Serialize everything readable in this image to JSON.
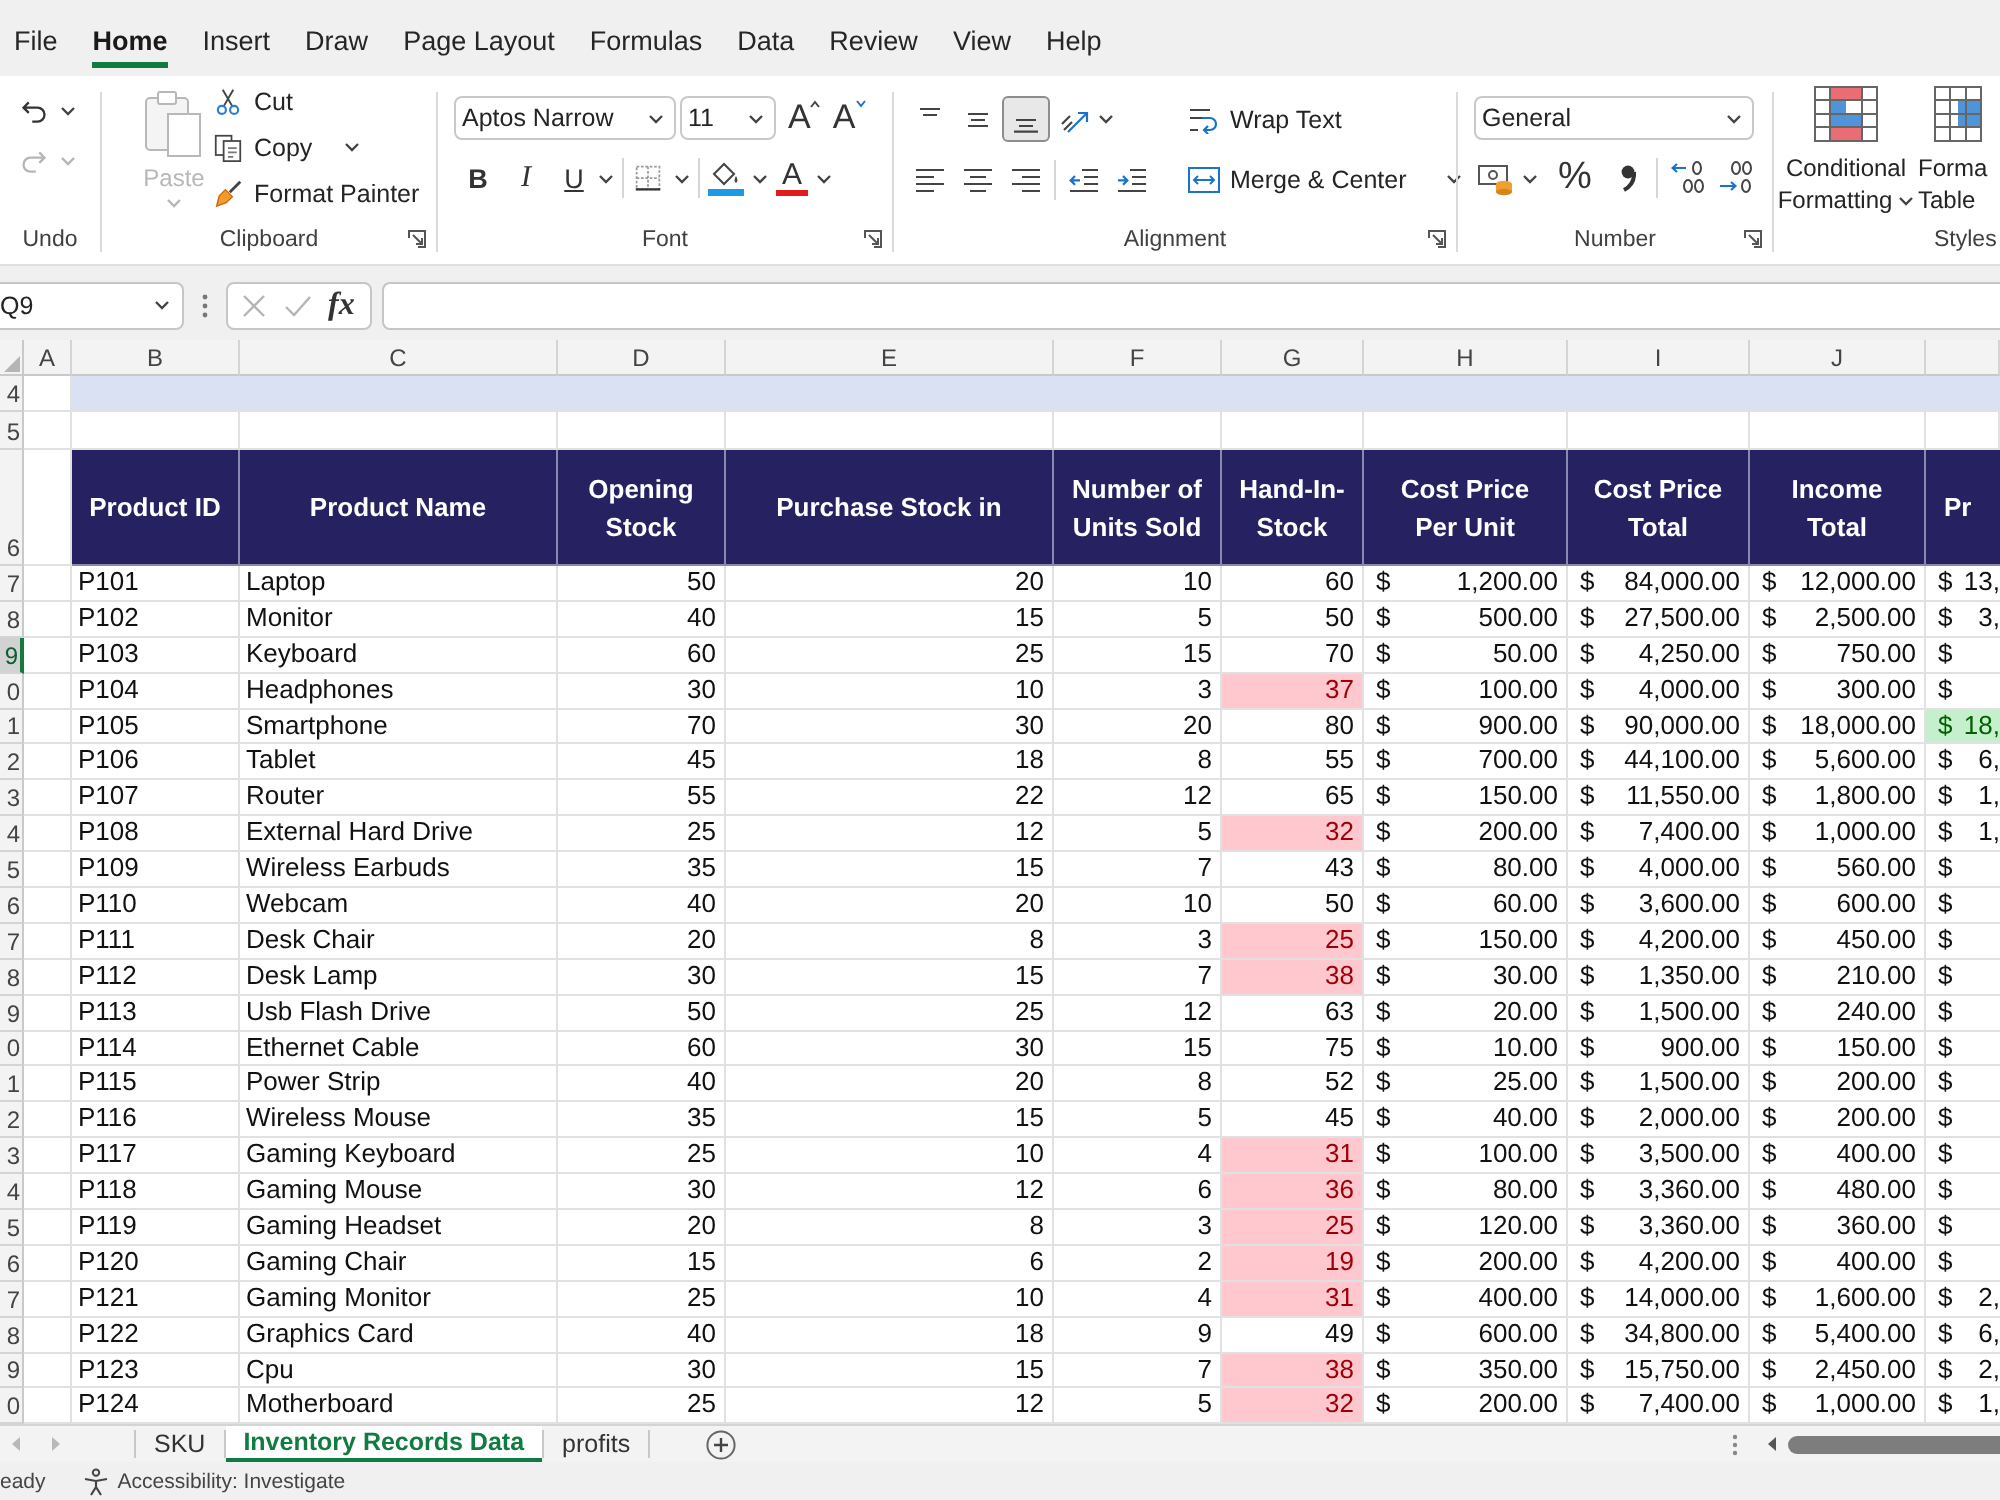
{
  "ribbon_tabs": [
    {
      "label": "File",
      "selected": false
    },
    {
      "label": "Home",
      "selected": true
    },
    {
      "label": "Insert",
      "selected": false
    },
    {
      "label": "Draw",
      "selected": false
    },
    {
      "label": "Page Layout",
      "selected": false
    },
    {
      "label": "Formulas",
      "selected": false
    },
    {
      "label": "Data",
      "selected": false
    },
    {
      "label": "Review",
      "selected": false
    },
    {
      "label": "View",
      "selected": false
    },
    {
      "label": "Help",
      "selected": false
    }
  ],
  "ribbon": {
    "undo": {
      "label": "Undo",
      "undo_disabled": false,
      "redo_disabled": true
    },
    "clipboard": {
      "label": "Clipboard",
      "paste": {
        "label": "Paste",
        "disabled": true
      },
      "cut": "Cut",
      "copy": "Copy",
      "format_painter": "Format Painter"
    },
    "font": {
      "label": "Font",
      "font_name": "Aptos Narrow",
      "font_size": "11",
      "grow_font": "A",
      "shrink_font": "A",
      "bold": "B",
      "italic": "I",
      "underline": "U",
      "font_color": "A"
    },
    "alignment": {
      "label": "Alignment",
      "vertical_align": [
        {
          "selected": false
        },
        {
          "selected": false
        },
        {
          "selected": true
        }
      ],
      "wrap_text": "Wrap Text",
      "merge_center": "Merge & Center"
    },
    "number": {
      "label": "Number",
      "format": "General",
      "percent": "%"
    },
    "styles": {
      "label": "Styles",
      "conditional_formatting": [
        "Conditional",
        "Formatting"
      ],
      "format_as_table": [
        "Forma",
        "Table"
      ]
    }
  },
  "formula_bar": {
    "name_box": "Q9",
    "edit_buttons_disabled": true,
    "function_label": "fx"
  },
  "sheet": {
    "column_letters": [
      "A",
      "B",
      "C",
      "D",
      "E",
      "F",
      "G",
      "H",
      "I",
      "J"
    ],
    "top_rows": [
      {
        "number": "4",
        "kind": "band"
      },
      {
        "number": "5",
        "kind": "blank"
      }
    ],
    "header_row": {
      "number": "6",
      "columns": [
        {
          "heading": "Product ID",
          "kind": "text"
        },
        {
          "heading": "Product Name",
          "kind": "text"
        },
        {
          "heading": "Opening Stock",
          "kind": "number"
        },
        {
          "heading": "Purchase Stock in",
          "kind": "number"
        },
        {
          "heading": "Number of Units Sold",
          "kind": "number"
        },
        {
          "heading": "Hand-In-Stock",
          "kind": "stock"
        },
        {
          "heading": "Cost Price Per Unit",
          "kind": "currency"
        },
        {
          "heading": "Cost Price Total",
          "kind": "currency"
        },
        {
          "heading": "Income Total",
          "kind": "currency"
        },
        {
          "heading": "Pr",
          "kind": "profit"
        }
      ]
    },
    "rows": [
      {
        "number": "7",
        "selected": false,
        "low_stock": false,
        "top_profit": false,
        "cells": [
          "P101",
          "Laptop",
          "50",
          "20",
          "10",
          "60",
          {
            "symbol": "$",
            "amount": "1,200.00"
          },
          {
            "symbol": "$",
            "amount": "84,000.00"
          },
          {
            "symbol": "$",
            "amount": "12,000.00"
          },
          {
            "symbol": "$",
            "amount": "13,"
          }
        ]
      },
      {
        "number": "8",
        "selected": false,
        "low_stock": false,
        "top_profit": false,
        "cells": [
          "P102",
          "Monitor",
          "40",
          "15",
          "5",
          "50",
          {
            "symbol": "$",
            "amount": "500.00"
          },
          {
            "symbol": "$",
            "amount": "27,500.00"
          },
          {
            "symbol": "$",
            "amount": "2,500.00"
          },
          {
            "symbol": "$",
            "amount": "3,"
          }
        ]
      },
      {
        "number": "9",
        "selected": true,
        "low_stock": false,
        "top_profit": false,
        "cells": [
          "P103",
          "Keyboard",
          "60",
          "25",
          "15",
          "70",
          {
            "symbol": "$",
            "amount": "50.00"
          },
          {
            "symbol": "$",
            "amount": "4,250.00"
          },
          {
            "symbol": "$",
            "amount": "750.00"
          },
          {
            "symbol": "$"
          }
        ]
      },
      {
        "number": "0",
        "selected": false,
        "low_stock": true,
        "top_profit": false,
        "cells": [
          "P104",
          "Headphones",
          "30",
          "10",
          "3",
          "37",
          {
            "symbol": "$",
            "amount": "100.00"
          },
          {
            "symbol": "$",
            "amount": "4,000.00"
          },
          {
            "symbol": "$",
            "amount": "300.00"
          },
          {
            "symbol": "$"
          }
        ]
      },
      {
        "number": "1",
        "selected": false,
        "low_stock": false,
        "top_profit": true,
        "cells": [
          "P105",
          "Smartphone",
          "70",
          "30",
          "20",
          "80",
          {
            "symbol": "$",
            "amount": "900.00"
          },
          {
            "symbol": "$",
            "amount": "90,000.00"
          },
          {
            "symbol": "$",
            "amount": "18,000.00"
          },
          {
            "symbol": "$",
            "amount": "18,"
          }
        ]
      },
      {
        "number": "2",
        "selected": false,
        "low_stock": false,
        "top_profit": false,
        "cells": [
          "P106",
          "Tablet",
          "45",
          "18",
          "8",
          "55",
          {
            "symbol": "$",
            "amount": "700.00"
          },
          {
            "symbol": "$",
            "amount": "44,100.00"
          },
          {
            "symbol": "$",
            "amount": "5,600.00"
          },
          {
            "symbol": "$",
            "amount": "6,"
          }
        ]
      },
      {
        "number": "3",
        "selected": false,
        "low_stock": false,
        "top_profit": false,
        "cells": [
          "P107",
          "Router",
          "55",
          "22",
          "12",
          "65",
          {
            "symbol": "$",
            "amount": "150.00"
          },
          {
            "symbol": "$",
            "amount": "11,550.00"
          },
          {
            "symbol": "$",
            "amount": "1,800.00"
          },
          {
            "symbol": "$",
            "amount": "1,"
          }
        ]
      },
      {
        "number": "4",
        "selected": false,
        "low_stock": true,
        "top_profit": false,
        "cells": [
          "P108",
          "External Hard Drive",
          "25",
          "12",
          "5",
          "32",
          {
            "symbol": "$",
            "amount": "200.00"
          },
          {
            "symbol": "$",
            "amount": "7,400.00"
          },
          {
            "symbol": "$",
            "amount": "1,000.00"
          },
          {
            "symbol": "$",
            "amount": "1,"
          }
        ]
      },
      {
        "number": "5",
        "selected": false,
        "low_stock": false,
        "top_profit": false,
        "cells": [
          "P109",
          "Wireless Earbuds",
          "35",
          "15",
          "7",
          "43",
          {
            "symbol": "$",
            "amount": "80.00"
          },
          {
            "symbol": "$",
            "amount": "4,000.00"
          },
          {
            "symbol": "$",
            "amount": "560.00"
          },
          {
            "symbol": "$"
          }
        ]
      },
      {
        "number": "6",
        "selected": false,
        "low_stock": false,
        "top_profit": false,
        "cells": [
          "P110",
          "Webcam",
          "40",
          "20",
          "10",
          "50",
          {
            "symbol": "$",
            "amount": "60.00"
          },
          {
            "symbol": "$",
            "amount": "3,600.00"
          },
          {
            "symbol": "$",
            "amount": "600.00"
          },
          {
            "symbol": "$"
          }
        ]
      },
      {
        "number": "7",
        "selected": false,
        "low_stock": true,
        "top_profit": false,
        "cells": [
          "P111",
          "Desk Chair",
          "20",
          "8",
          "3",
          "25",
          {
            "symbol": "$",
            "amount": "150.00"
          },
          {
            "symbol": "$",
            "amount": "4,200.00"
          },
          {
            "symbol": "$",
            "amount": "450.00"
          },
          {
            "symbol": "$"
          }
        ]
      },
      {
        "number": "8",
        "selected": false,
        "low_stock": true,
        "top_profit": false,
        "cells": [
          "P112",
          "Desk Lamp",
          "30",
          "15",
          "7",
          "38",
          {
            "symbol": "$",
            "amount": "30.00"
          },
          {
            "symbol": "$",
            "amount": "1,350.00"
          },
          {
            "symbol": "$",
            "amount": "210.00"
          },
          {
            "symbol": "$"
          }
        ]
      },
      {
        "number": "9",
        "selected": false,
        "low_stock": false,
        "top_profit": false,
        "cells": [
          "P113",
          "Usb Flash Drive",
          "50",
          "25",
          "12",
          "63",
          {
            "symbol": "$",
            "amount": "20.00"
          },
          {
            "symbol": "$",
            "amount": "1,500.00"
          },
          {
            "symbol": "$",
            "amount": "240.00"
          },
          {
            "symbol": "$"
          }
        ]
      },
      {
        "number": "0",
        "selected": false,
        "low_stock": false,
        "top_profit": false,
        "cells": [
          "P114",
          "Ethernet Cable",
          "60",
          "30",
          "15",
          "75",
          {
            "symbol": "$",
            "amount": "10.00"
          },
          {
            "symbol": "$",
            "amount": "900.00"
          },
          {
            "symbol": "$",
            "amount": "150.00"
          },
          {
            "symbol": "$"
          }
        ]
      },
      {
        "number": "1",
        "selected": false,
        "low_stock": false,
        "top_profit": false,
        "cells": [
          "P115",
          "Power Strip",
          "40",
          "20",
          "8",
          "52",
          {
            "symbol": "$",
            "amount": "25.00"
          },
          {
            "symbol": "$",
            "amount": "1,500.00"
          },
          {
            "symbol": "$",
            "amount": "200.00"
          },
          {
            "symbol": "$"
          }
        ]
      },
      {
        "number": "2",
        "selected": false,
        "low_stock": false,
        "top_profit": false,
        "cells": [
          "P116",
          "Wireless Mouse",
          "35",
          "15",
          "5",
          "45",
          {
            "symbol": "$",
            "amount": "40.00"
          },
          {
            "symbol": "$",
            "amount": "2,000.00"
          },
          {
            "symbol": "$",
            "amount": "200.00"
          },
          {
            "symbol": "$"
          }
        ]
      },
      {
        "number": "3",
        "selected": false,
        "low_stock": true,
        "top_profit": false,
        "cells": [
          "P117",
          "Gaming Keyboard",
          "25",
          "10",
          "4",
          "31",
          {
            "symbol": "$",
            "amount": "100.00"
          },
          {
            "symbol": "$",
            "amount": "3,500.00"
          },
          {
            "symbol": "$",
            "amount": "400.00"
          },
          {
            "symbol": "$"
          }
        ]
      },
      {
        "number": "4",
        "selected": false,
        "low_stock": true,
        "top_profit": false,
        "cells": [
          "P118",
          "Gaming Mouse",
          "30",
          "12",
          "6",
          "36",
          {
            "symbol": "$",
            "amount": "80.00"
          },
          {
            "symbol": "$",
            "amount": "3,360.00"
          },
          {
            "symbol": "$",
            "amount": "480.00"
          },
          {
            "symbol": "$"
          }
        ]
      },
      {
        "number": "5",
        "selected": false,
        "low_stock": true,
        "top_profit": false,
        "cells": [
          "P119",
          "Gaming Headset",
          "20",
          "8",
          "3",
          "25",
          {
            "symbol": "$",
            "amount": "120.00"
          },
          {
            "symbol": "$",
            "amount": "3,360.00"
          },
          {
            "symbol": "$",
            "amount": "360.00"
          },
          {
            "symbol": "$"
          }
        ]
      },
      {
        "number": "6",
        "selected": false,
        "low_stock": true,
        "top_profit": false,
        "cells": [
          "P120",
          "Gaming Chair",
          "15",
          "6",
          "2",
          "19",
          {
            "symbol": "$",
            "amount": "200.00"
          },
          {
            "symbol": "$",
            "amount": "4,200.00"
          },
          {
            "symbol": "$",
            "amount": "400.00"
          },
          {
            "symbol": "$"
          }
        ]
      },
      {
        "number": "7",
        "selected": false,
        "low_stock": true,
        "top_profit": false,
        "cells": [
          "P121",
          "Gaming Monitor",
          "25",
          "10",
          "4",
          "31",
          {
            "symbol": "$",
            "amount": "400.00"
          },
          {
            "symbol": "$",
            "amount": "14,000.00"
          },
          {
            "symbol": "$",
            "amount": "1,600.00"
          },
          {
            "symbol": "$",
            "amount": "2,"
          }
        ]
      },
      {
        "number": "8",
        "selected": false,
        "low_stock": false,
        "top_profit": false,
        "cells": [
          "P122",
          "Graphics Card",
          "40",
          "18",
          "9",
          "49",
          {
            "symbol": "$",
            "amount": "600.00"
          },
          {
            "symbol": "$",
            "amount": "34,800.00"
          },
          {
            "symbol": "$",
            "amount": "5,400.00"
          },
          {
            "symbol": "$",
            "amount": "6,"
          }
        ]
      },
      {
        "number": "9",
        "selected": false,
        "low_stock": true,
        "top_profit": false,
        "cells": [
          "P123",
          "Cpu",
          "30",
          "15",
          "7",
          "38",
          {
            "symbol": "$",
            "amount": "350.00"
          },
          {
            "symbol": "$",
            "amount": "15,750.00"
          },
          {
            "symbol": "$",
            "amount": "2,450.00"
          },
          {
            "symbol": "$",
            "amount": "2,"
          }
        ]
      },
      {
        "number": "0",
        "selected": false,
        "low_stock": true,
        "top_profit": false,
        "cells": [
          "P124",
          "Motherboard",
          "25",
          "12",
          "5",
          "32",
          {
            "symbol": "$",
            "amount": "200.00"
          },
          {
            "symbol": "$",
            "amount": "7,400.00"
          },
          {
            "symbol": "$",
            "amount": "1,000.00"
          },
          {
            "symbol": "$",
            "amount": "1,"
          }
        ]
      }
    ]
  },
  "sheet_tabs": [
    {
      "label": "SKU",
      "selected": false
    },
    {
      "label": "Inventory Records Data",
      "selected": true
    },
    {
      "label": "profits",
      "selected": false
    }
  ],
  "status_bar": {
    "mode": "eady",
    "accessibility": "Accessibility: Investigate"
  }
}
